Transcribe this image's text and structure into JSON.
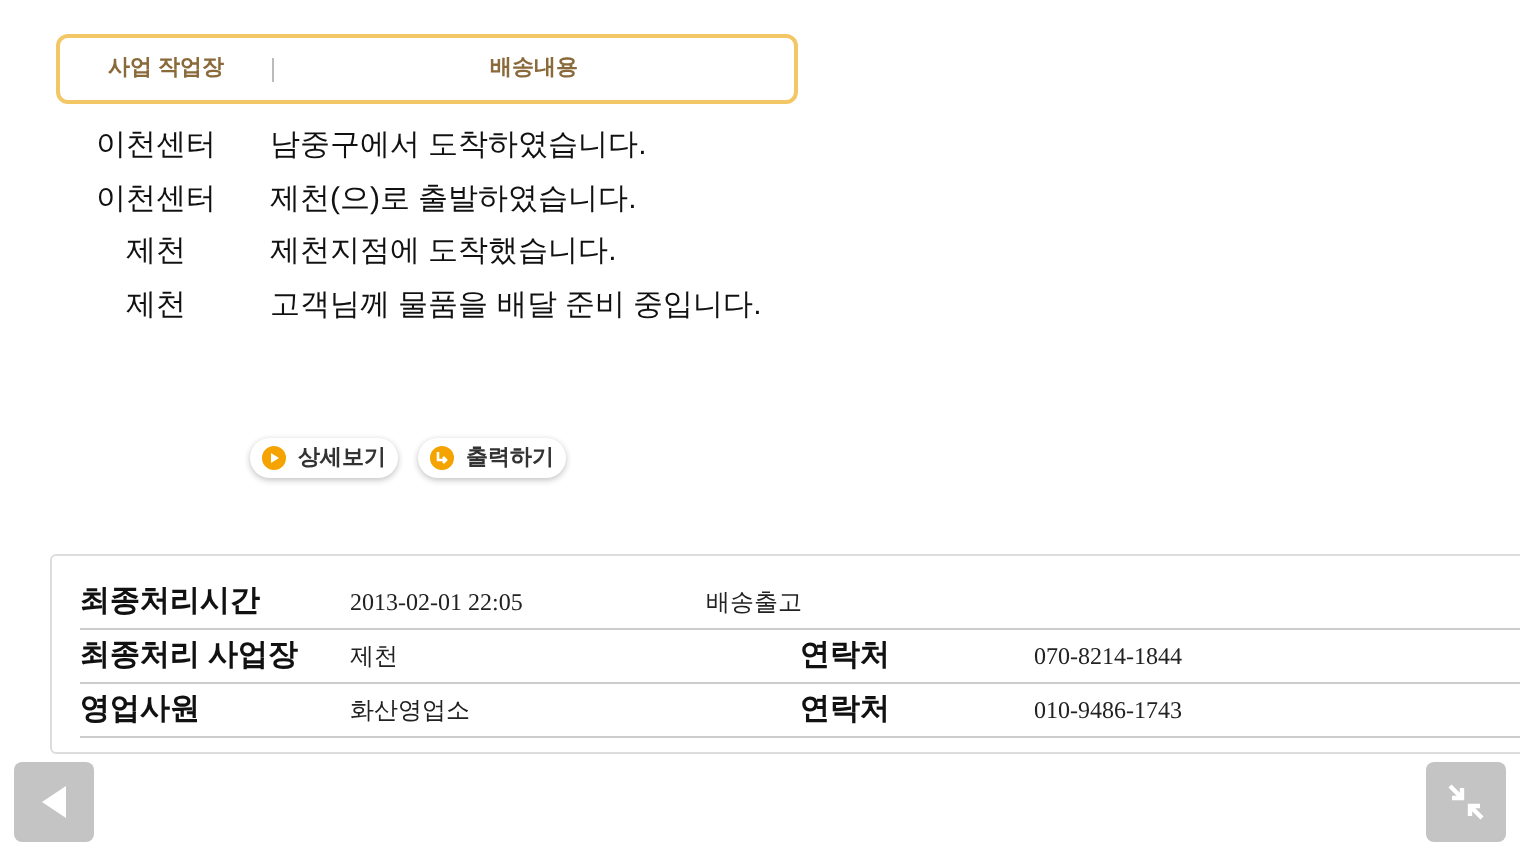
{
  "tracking": {
    "columns": [
      "사업 작업장",
      "배송내용"
    ],
    "rows": [
      {
        "place": "이천센터",
        "status": "남중구에서 도착하였습니다."
      },
      {
        "place": "이천센터",
        "status": "제천(으)로 출발하였습니다."
      },
      {
        "place": "제천",
        "status": "제천지점에 도착했습니다."
      },
      {
        "place": "제천",
        "status": "고객님께 물품을 배달 준비 중입니다."
      }
    ]
  },
  "actions": [
    {
      "label": "상세보기",
      "kind": "play"
    },
    {
      "label": "출력하기",
      "kind": "return"
    }
  ],
  "details": [
    {
      "label": "최종처리시간",
      "value": "2013-02-01 22:05",
      "note": "배송출고"
    },
    {
      "label": "최종처리 사업장",
      "value": "제천",
      "contact_label": "연락처",
      "contact_value": "070-8214-1844"
    },
    {
      "label": "영업사원",
      "value": "화산영업소",
      "contact_label": "연락처",
      "contact_value": "010-9486-1743"
    }
  ]
}
